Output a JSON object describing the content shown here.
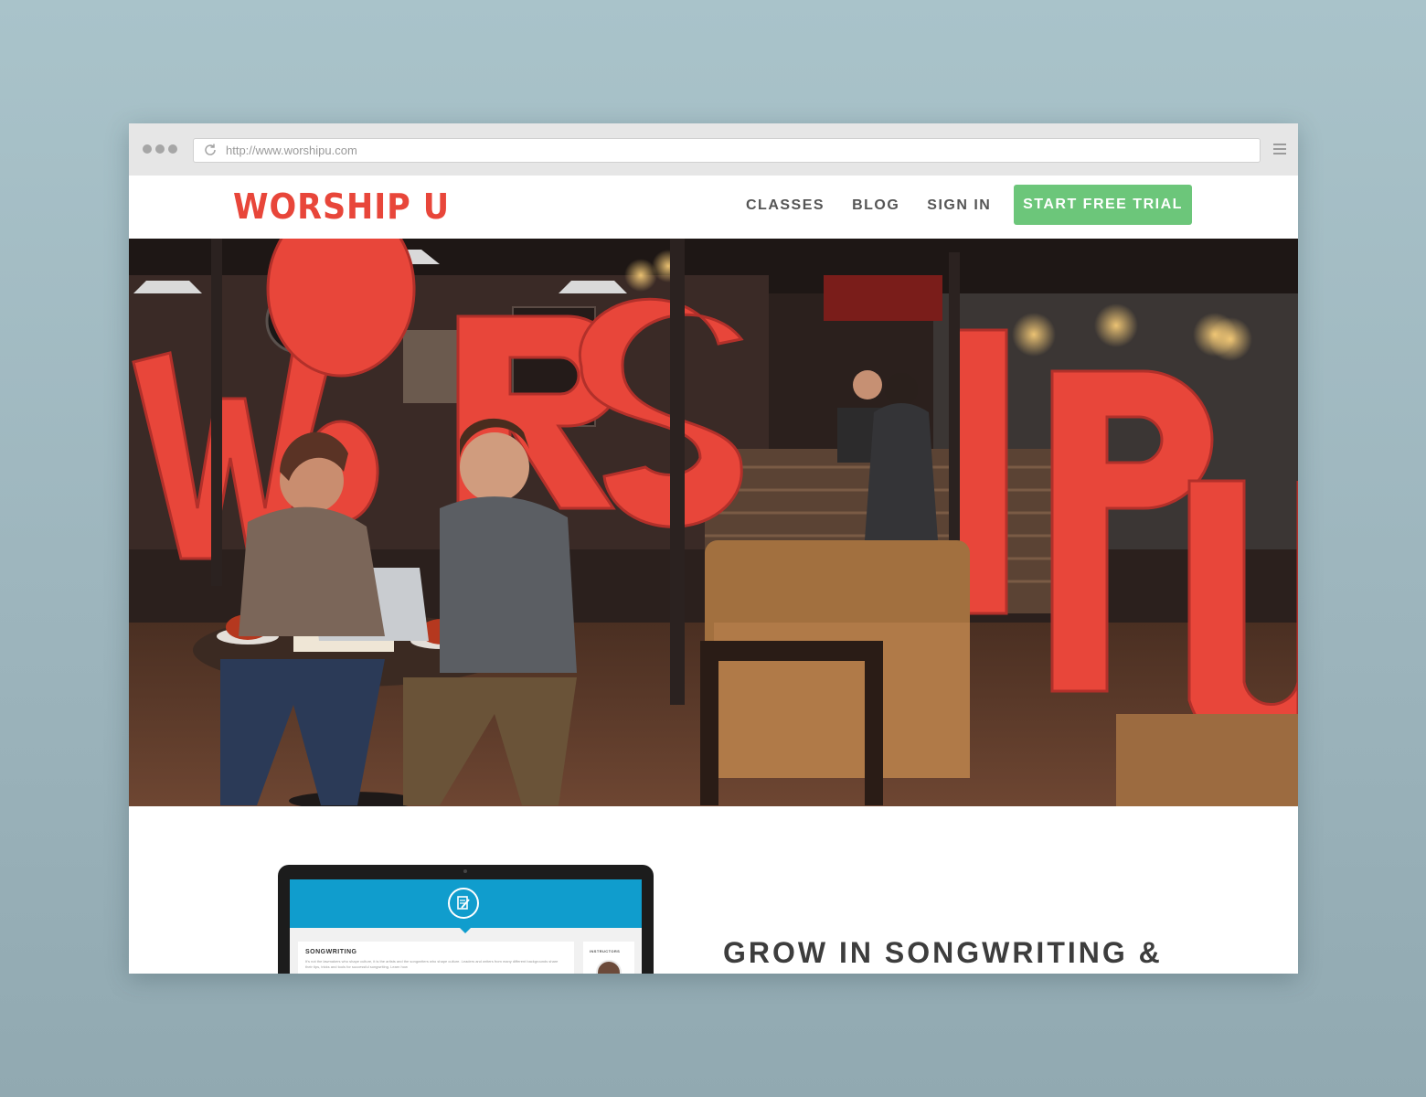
{
  "browser": {
    "url": "http://www.worshipu.com"
  },
  "header": {
    "logo": "WORSHIP U",
    "nav": [
      "CLASSES",
      "BLOG",
      "SIGN IN"
    ],
    "cta": "START FREE TRIAL"
  },
  "hero": {
    "sign_letters": "WORSHIPU"
  },
  "feature": {
    "screen_title": "SONGWRITING",
    "screen_text": "It's not the lawmakers who shape culture, it is the artists and the songwriters who shape culture. Leaders and writers from many different backgrounds share their tips, tricks and tools for successful songwriting. Learn how",
    "screen_side_title": "INSTRUCTORS",
    "headline": "GROW IN SONGWRITING &"
  },
  "colors": {
    "brand_red": "#e8463a",
    "cta_green": "#6cc67a",
    "screen_blue": "#109dcd",
    "background": "#a9c3ca"
  },
  "icons": [
    "reload-icon",
    "menu-icon",
    "edit-document-icon"
  ]
}
